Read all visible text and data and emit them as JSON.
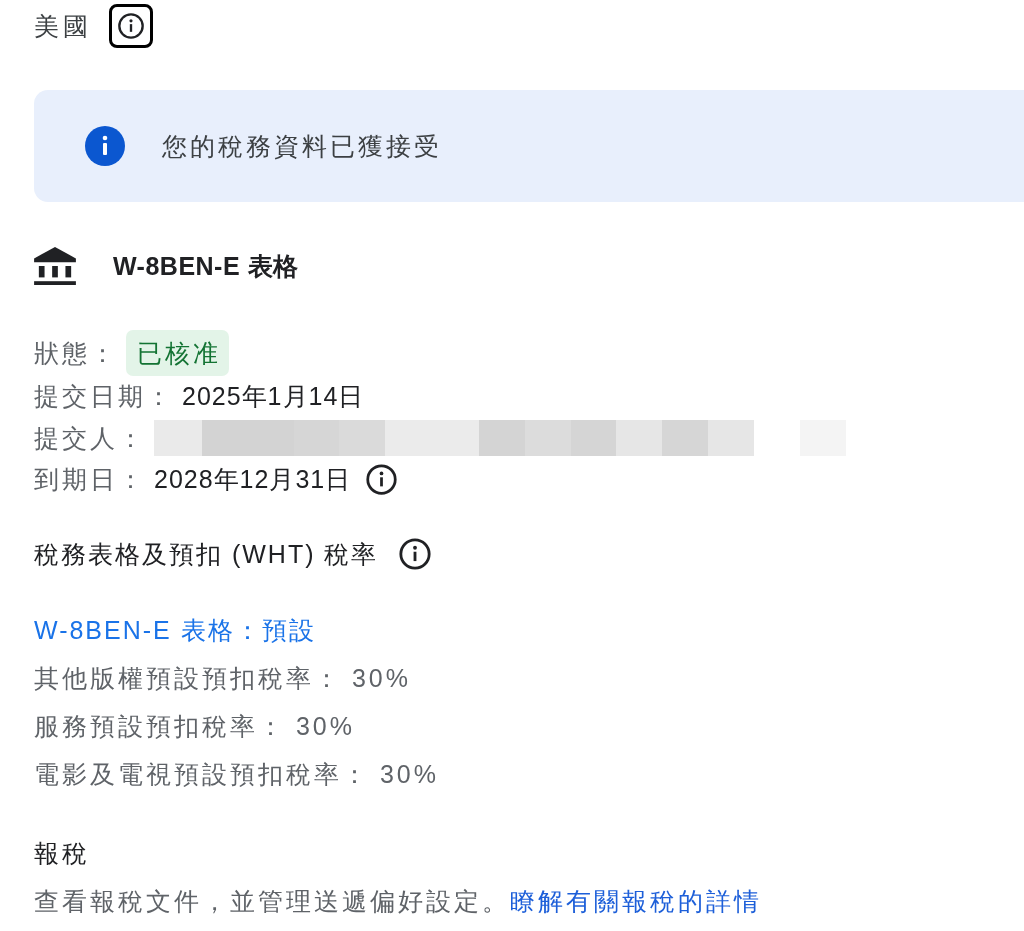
{
  "country": {
    "name": "美國",
    "info_button": {
      "focused": true
    }
  },
  "banner": {
    "kind": "info",
    "message": "您的稅務資料已獲接受"
  },
  "form": {
    "title": "W-8BEN-E 表格",
    "fields": [
      {
        "kind": "status",
        "label": "狀態：",
        "value": "已核准"
      },
      {
        "kind": "text",
        "label": "提交日期：",
        "value": "2025年1月14日",
        "info": false
      },
      {
        "kind": "redacted",
        "label": "提交人："
      },
      {
        "kind": "text",
        "label": "到期日：",
        "value": "2028年12月31日",
        "info": true
      }
    ]
  },
  "rates": {
    "heading": "稅務表格及預扣 (WHT) 稅率",
    "link": "W-8BEN-E 表格：預設",
    "items": [
      "其他版權預設預扣稅率： 30%",
      "服務預設預扣稅率： 30%",
      "電影及電視預設預扣稅率： 30%"
    ]
  },
  "filing": {
    "heading": "報稅",
    "text": "查看報稅文件，並管理送遞偏好設定。",
    "link": "瞭解有關報稅的詳情"
  }
}
